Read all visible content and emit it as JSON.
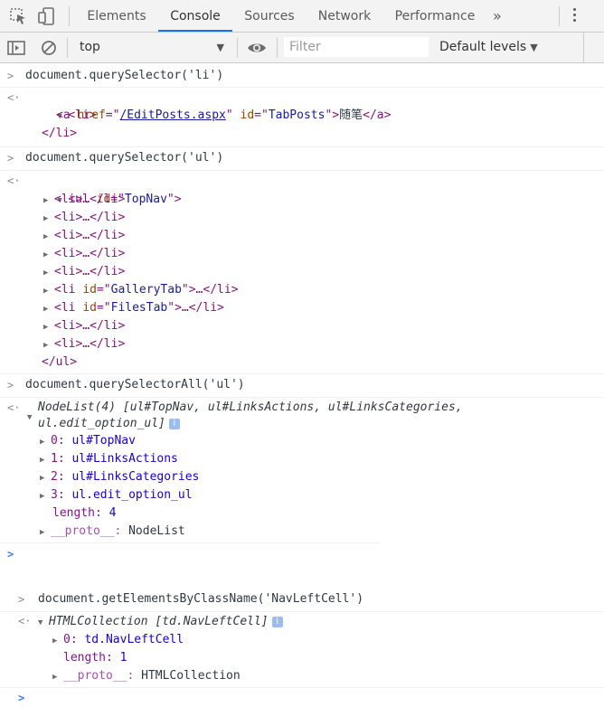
{
  "tabs": [
    "Elements",
    "Console",
    "Sources",
    "Network",
    "Performance"
  ],
  "more_tabs_glyph": "»",
  "toolbar": {
    "context": "top",
    "filter_placeholder": "Filter",
    "levels": "Default levels"
  },
  "icons": {
    "inspect": "inspect-icon",
    "device": "device-toggle-icon",
    "sidebar": "sidebar-toggle-icon",
    "clear": "clear-console-icon",
    "eye": "live-expression-icon",
    "menu": "kebab-menu-icon"
  },
  "colors": {
    "accent": "#1a73e8",
    "prompt_blue": "#367cf1",
    "tag": "#881280",
    "attr": "#994500",
    "value": "#1a1aa6"
  },
  "console": {
    "entry1": {
      "command": "document.querySelector('li')",
      "lines": [
        {
          "open": "<li>"
        },
        {
          "a_open": "<a ",
          "href_attr": "href",
          "eq1": "=\"",
          "href_val": "/EditPosts.aspx",
          "eq2": "\" ",
          "id_attr": "id",
          "id_eq": "=\"",
          "id_val": "TabPosts",
          "close_q": "\">",
          "text": "随笔",
          "a_close": "</a>"
        },
        {
          "close": "</li>"
        }
      ]
    },
    "entry2": {
      "command": "document.querySelector('ul')",
      "open": {
        "tag": "<ul ",
        "attr": "id",
        "eq": "=\"",
        "val": "TopNav",
        "close": "\">"
      },
      "children": [
        "<li>…</li>",
        "<li>…</li>",
        "<li>…</li>",
        "<li>…</li>",
        "<li>…</li>",
        {
          "tag": "<li ",
          "attr": "id",
          "eq": "=\"",
          "val": "GalleryTab",
          "close": "\">…</li>"
        },
        {
          "tag": "<li ",
          "attr": "id",
          "eq": "=\"",
          "val": "FilesTab",
          "close": "\">…</li>"
        },
        "<li>…</li>",
        "<li>…</li>"
      ],
      "close": "</ul>"
    },
    "entry3": {
      "command": "document.querySelectorAll('ul')",
      "summary_line1": "NodeList(4) [ul#TopNav, ul#LinksActions, ul#LinksCategories,",
      "summary_line2": "ul.edit_option_ul]",
      "items": [
        {
          "key": "0",
          "val": "ul#TopNav"
        },
        {
          "key": "1",
          "val": "ul#LinksActions"
        },
        {
          "key": "2",
          "val": "ul#LinksCategories"
        },
        {
          "key": "3",
          "val": "ul.edit_option_ul"
        }
      ],
      "length_key": "length",
      "length_val": "4",
      "proto_key": "__proto__",
      "proto_val": "NodeList"
    },
    "entry4": {
      "command": "document.getElementsByClassName('NavLeftCell')",
      "summary": "HTMLCollection [td.NavLeftCell]",
      "items": [
        {
          "key": "0",
          "val": "td.NavLeftCell"
        }
      ],
      "length_key": "length",
      "length_val": "1",
      "proto_key": "__proto__",
      "proto_val": "HTMLCollection"
    }
  }
}
